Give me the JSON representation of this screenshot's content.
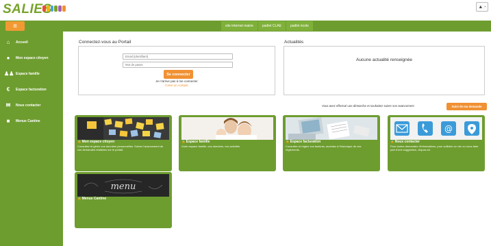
{
  "header": {
    "logo_text": "SALIES",
    "user_icon": "user-icon",
    "user_label": "▲ -",
    "badge_colors": [
      "#e94b3c",
      "#f4b400",
      "#4aa3df",
      "#76a32a",
      "#a35fb5",
      "#f09133"
    ]
  },
  "topnav": {
    "menu_icon": "hamburger-icon",
    "links": [
      "site internet mairie",
      "padlet CLAE",
      "padlet école"
    ]
  },
  "sidebar": {
    "items": [
      {
        "label": "Accueil",
        "icon": "home-icon",
        "glyph": "🏠"
      },
      {
        "label": "Mon espace citoyen",
        "icon": "user-icon",
        "glyph": "👤"
      },
      {
        "label": "Espace famille",
        "icon": "family-icon",
        "glyph": "👪"
      },
      {
        "label": "Espace facturation",
        "icon": "euro-icon",
        "glyph": "€"
      },
      {
        "label": "Nous contacter",
        "icon": "envelope-icon",
        "glyph": "✉"
      },
      {
        "label": "Menus Cantine",
        "icon": "square-icon",
        "glyph": "■"
      }
    ]
  },
  "login": {
    "title": "Connectez-vous au Portail",
    "email_placeholder": "Email (identifiant)",
    "password_placeholder": "Mot de passe",
    "connect_label": "Se connecter",
    "forgot_label": "Je n'arrive pas à me connecter",
    "create_label": "Créer un compte"
  },
  "news": {
    "title": "Actualités",
    "empty_text": "Aucune actualité renseignée"
  },
  "follow": {
    "text": "Vous avez effectué une démarche et souhaitez suivre son avancement",
    "button_label": "Suivi de ma demande"
  },
  "tiles": [
    {
      "title": "Mon espace citoyen",
      "desc": "Consultez et gérez vos données personnelles. Suivez l'avancement de vos demandes réalisées sur le portail."
    },
    {
      "title": "Espace famille",
      "desc": "Votre espace famille, vos données, vos activités."
    },
    {
      "title": "Espace facturation",
      "desc": "Consultez et réglez vos factures, accédez à l'historique de vos règlements."
    },
    {
      "title": "Nous contacter",
      "desc": "Pour toutes demandes d'informations, pour solliciter un rdv ou nous faire part d'une suggestion, cliquez-ici."
    },
    {
      "title": "Menus Cantine",
      "desc": ""
    }
  ],
  "colors": {
    "green": "#6e9d2f",
    "orange": "#f09133"
  }
}
